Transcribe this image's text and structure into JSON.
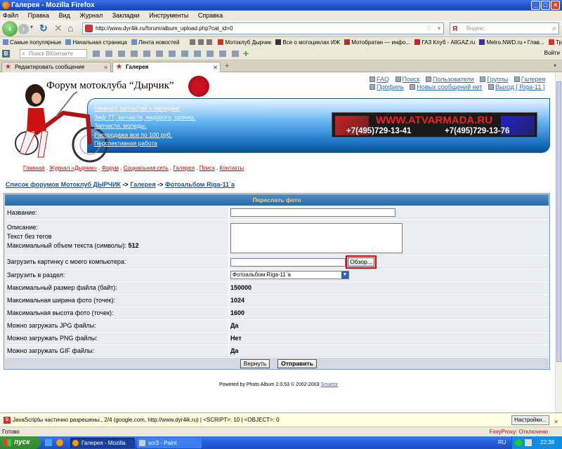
{
  "window": {
    "title": "Галерея - Mozilla Firefox"
  },
  "menu": [
    "Файл",
    "Правка",
    "Вид",
    "Журнал",
    "Закладки",
    "Инструменты",
    "Справка"
  ],
  "nav": {
    "url": "http://www.dyr4ik.ru/forum/album_upload.php?cat_id=0",
    "search_placeholder": "Яндекс"
  },
  "bookmarks": [
    "Самые популярные",
    "Начальная страница",
    "Лента новостей",
    "Мотоклуб Дырчик",
    "Все о мотоциклах ИЖ",
    "Мотобратан — инфо...",
    "ГАЗ Клуб - AllGAZ.ru",
    "Metro.NWD.ru • Глав...",
    "Транспорт в России |"
  ],
  "vk": {
    "search_placeholder": "Поиск ВКонтакте",
    "logout": "Войти"
  },
  "tabs": [
    {
      "label": "Редактировать сообщение",
      "active": false
    },
    {
      "label": "Галерея",
      "active": true
    }
  ],
  "page": {
    "forum_title": "Форум мотоклуба “Дырчик”",
    "top_links_row1": [
      "FAQ",
      "Поиск",
      "Пользователи",
      "Группы",
      "Галерея"
    ],
    "top_links_row2": [
      "Профиль",
      "Новых сообщений нет",
      "Выход [ Riga-11 ]"
    ],
    "banner_links": [
      "Немного запчастей к мопедам!",
      "Зиф 77, запчасти, недорого, срочно.",
      "Запчасти, мопеды.",
      "Распродажа все по 100 руб.",
      "Перспективная работа"
    ],
    "ad": {
      "url": "WWW.ATVARMADA.RU",
      "phone1": "+7(495)729-13-41",
      "phone2": "+7(495)729-13-76"
    },
    "nav_links": [
      "Главная",
      "Журнал «Дырчик»",
      "Форум",
      "Социальная сеть",
      "Галерея",
      "Поиск",
      "Контакты"
    ],
    "breadcrumb": [
      "Список форумов Мотоклуб ДЫРЧИК",
      "Галерея",
      "Фотоальбом Riga-11`a"
    ],
    "breadcrumb_sep": "->",
    "form": {
      "header": "Переслать фото",
      "name_label": "Название:",
      "desc_label": "Описание:",
      "desc_note": "Текст без тегов",
      "desc_max_label": "Максимальный объем текста (символы):",
      "desc_max_value": "512",
      "upload_label": "Загрузить картинку с моего компьютера:",
      "browse": "Обзор...",
      "section_label": "Загрузить в раздел:",
      "section_value": "Фотоальбом Riga-11`a",
      "rows": [
        {
          "label": "Максимальный размер файла (байт):",
          "value": "150000"
        },
        {
          "label": "Максимальная ширина фото (точек):",
          "value": "1024"
        },
        {
          "label": "Максимальная высота фото (точек):",
          "value": "1600"
        },
        {
          "label": "Можно загружать JPG файлы:",
          "value": "Да"
        },
        {
          "label": "Можно загружать PNG файлы:",
          "value": "Нет"
        },
        {
          "label": "Можно загружать GIF файлы:",
          "value": "Да"
        }
      ],
      "reset": "Вернуть",
      "submit": "Отправить"
    },
    "footer_text": "Powered by Photo Album 2.0.53 © 2002-2003",
    "footer_link": "Smartor"
  },
  "jsbar": {
    "text": "JavaScriptы частично разрешены., 2/4 (google.com, http://www.dyr4ik.ru) | <SCRIPT>: 10 | <OBJECT>: 0",
    "settings": "Настройки..."
  },
  "status": {
    "text": "Готово",
    "foxy": "FoxyProxy: Отключено"
  },
  "taskbar": {
    "start": "пуск",
    "items": [
      "Галерея - Mozilla Fire...",
      "scr3 - Paint"
    ],
    "lang": "RU",
    "clock": "22:38"
  }
}
